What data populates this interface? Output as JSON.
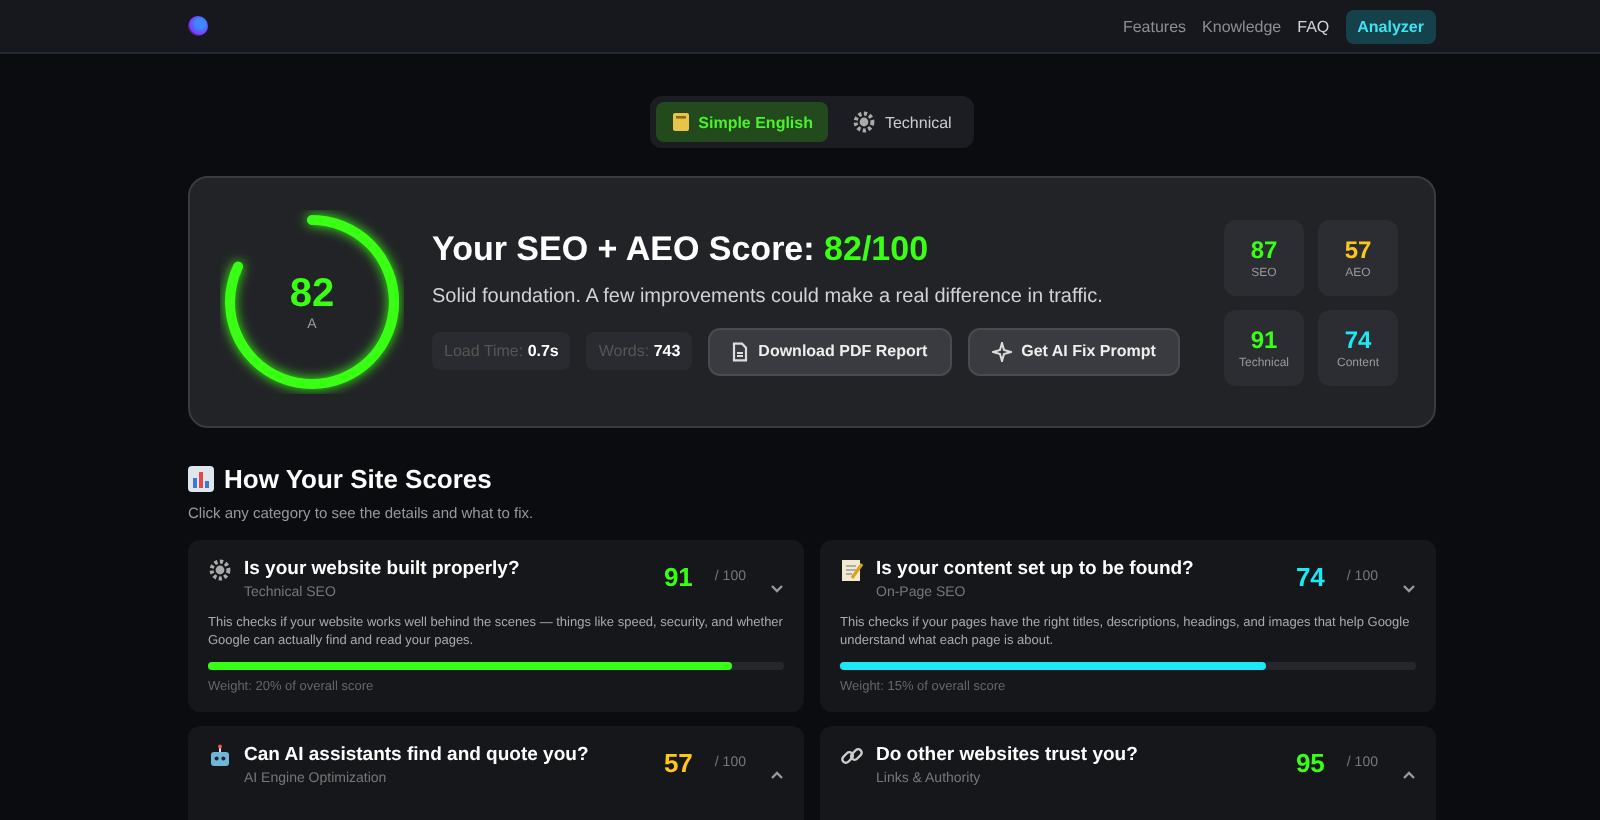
{
  "nav": {
    "links": [
      {
        "label": "Features",
        "selected": false
      },
      {
        "label": "Knowledge",
        "selected": false
      },
      {
        "label": "FAQ",
        "selected": true
      }
    ],
    "cta": "Analyzer"
  },
  "mode_toggle": [
    {
      "label": "Simple English",
      "selected": true,
      "kind": "book"
    },
    {
      "label": "Technical",
      "selected": false,
      "kind": "gear"
    }
  ],
  "score": {
    "value": "82",
    "grade": "A",
    "level": 0.82,
    "color": "#39ff14",
    "title": "Your SEO + AEO Score: ",
    "title_score": "82/100",
    "summary": "Solid foundation. A few improvements could make a real difference in traffic.",
    "stats": [
      {
        "label": "Load Time:",
        "value": "0.7s"
      },
      {
        "label": "Words:",
        "value": "743"
      }
    ],
    "buttons": [
      {
        "label": "Download PDF Report",
        "kind": "document"
      },
      {
        "label": "Get AI Fix Prompt",
        "kind": "sparkle"
      }
    ],
    "subscores": [
      {
        "value": "87",
        "label": "SEO",
        "color": "#39ff14"
      },
      {
        "value": "57",
        "label": "AEO",
        "color": "#ffc61a"
      },
      {
        "value": "91",
        "label": "Technical",
        "color": "#39ff14"
      },
      {
        "value": "74",
        "label": "Content",
        "color": "#1de9f6"
      }
    ]
  },
  "section": {
    "title": "How Your Site Scores",
    "subtitle": "Click any category to see the details and what to fix."
  },
  "categories": [
    {
      "kind": "gear",
      "title": "Is your website built properly?",
      "subtitle": "Technical SEO",
      "score": "91",
      "out_of": "/ 100",
      "color": "#39ff14",
      "expanded": true,
      "description": "This checks if your website works well behind the scenes — things like speed, security, and whether Google can actually find and read your pages.",
      "level": 0.91,
      "weight": "Weight: 20% of overall score"
    },
    {
      "kind": "note",
      "title": "Is your content set up to be found?",
      "subtitle": "On-Page SEO",
      "score": "74",
      "out_of": "/ 100",
      "color": "#1de9f6",
      "expanded": true,
      "description": "This checks if your pages have the right titles, descriptions, headings, and images that help Google understand what each page is about.",
      "level": 0.74,
      "weight": "Weight: 15% of overall score"
    },
    {
      "kind": "robot",
      "title": "Can AI assistants find and quote you?",
      "subtitle": "AI Engine Optimization",
      "score": "57",
      "out_of": "/ 100",
      "color": "#ffc61a",
      "expanded": false
    },
    {
      "kind": "link",
      "title": "Do other websites trust you?",
      "subtitle": "Links & Authority",
      "score": "95",
      "out_of": "/ 100",
      "color": "#39ff14",
      "expanded": false
    }
  ]
}
